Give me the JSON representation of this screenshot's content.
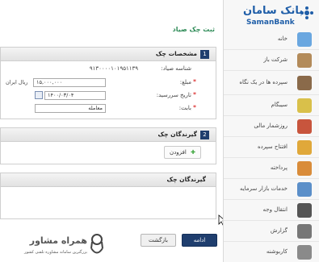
{
  "brand": {
    "name_fa": "بانک سامان",
    "name_en": "SamanBank",
    "color": "#1f5ea8"
  },
  "sidebar": {
    "items": [
      {
        "label": "خانه",
        "icon": "home-icon",
        "color": "#6aa7e0"
      },
      {
        "label": "شرکت باز",
        "icon": "briefcase-icon",
        "color": "#b38b5a"
      },
      {
        "label": "سپرده ها در یک نگاه",
        "icon": "safe-icon",
        "color": "#8a6a4a"
      },
      {
        "label": "سیبگام",
        "icon": "folder-icon",
        "color": "#d9c04a"
      },
      {
        "label": "روزشمار مالی",
        "icon": "calendar-icon",
        "color": "#c8553d"
      },
      {
        "label": "افتتاح سپرده",
        "icon": "deposit-icon",
        "color": "#e0a83a"
      },
      {
        "label": "پرداخته",
        "icon": "payment-icon",
        "color": "#d98c3a"
      },
      {
        "label": "خدمات بازار سرمایه",
        "icon": "chart-icon",
        "color": "#5b8fc9"
      },
      {
        "label": "انتقال وجه",
        "icon": "transfer-icon",
        "color": "#555555"
      },
      {
        "label": "گزارش",
        "icon": "report-icon",
        "color": "#777777"
      },
      {
        "label": "کاربوشنه",
        "icon": "user-icon",
        "color": "#8a8a8a"
      }
    ]
  },
  "page": {
    "title": "ثبت چک صیاد"
  },
  "section1": {
    "number": "1",
    "title": "مشخصات چک",
    "fields": {
      "sayad_label": "شناسه صیاد:",
      "sayad_value": "۹۱۳۰۰۰۰۱۰۱۹۵۱۱۳۹",
      "amount_label": "مبلغ:",
      "amount_value": "۱۵,۰۰۰,۰۰۰",
      "amount_unit": "ریال ایران",
      "due_label": "تاریخ سررسید:",
      "due_value": "۱۴۰۰/۰۳/۰۴",
      "reason_label": "بابت:",
      "reason_value": "معامله"
    }
  },
  "section2": {
    "number": "2",
    "title": "گیرندگان چک",
    "add_label": "افزودن"
  },
  "section3": {
    "title": "گیرندگان چک"
  },
  "actions": {
    "continue_label": "ادامه",
    "back_label": "بازگشت"
  },
  "watermark": {
    "title": "همراه مشاور",
    "subtitle": "بزرگترین سامانه مشاوره تلفنی کشور"
  }
}
